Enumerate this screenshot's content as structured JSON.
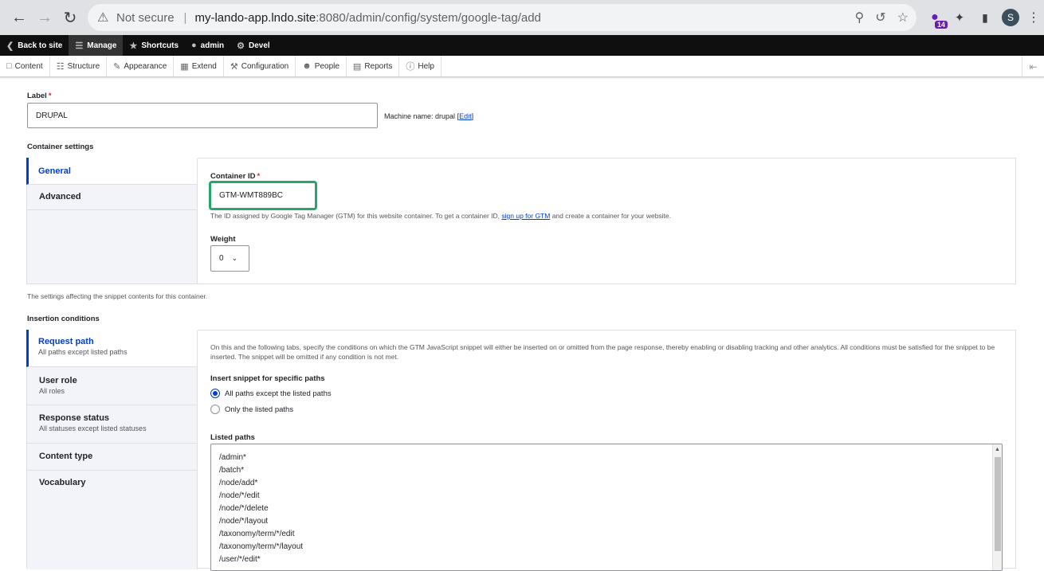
{
  "browser": {
    "warning_text": "Not secure",
    "url_host": "my-lando-app.lndo.site",
    "url_path": ":8080/admin/config/system/google-tag/add",
    "extension_badge": "14",
    "profile_initial": "S"
  },
  "toolbar": {
    "back_to_site": "Back to site",
    "manage": "Manage",
    "shortcuts": "Shortcuts",
    "user": "admin",
    "devel": "Devel"
  },
  "tray": {
    "items": [
      "Content",
      "Structure",
      "Appearance",
      "Extend",
      "Configuration",
      "People",
      "Reports",
      "Help"
    ]
  },
  "form": {
    "label_title": "Label",
    "label_value": "DRUPAL",
    "machine_name_prefix": "Machine name: drupal",
    "machine_edit_link": "Edit",
    "container_settings_title": "Container settings",
    "container_tabs": [
      {
        "title": "General"
      },
      {
        "title": "Advanced"
      }
    ],
    "container_id_label": "Container ID",
    "container_id_value": "GTM-WMT889BC",
    "container_desc_before": "The ID assigned by Google Tag Manager (GTM) for this website container. To get a container ID,",
    "container_desc_link": "sign up for GTM",
    "container_desc_after": "and create a container for your website.",
    "weight_label": "Weight",
    "weight_value": "0",
    "settings_note": "The settings affecting the snippet contents for this container.",
    "insertion_title": "Insertion conditions",
    "insertion_tabs": [
      {
        "title": "Request path",
        "summary": "All paths except listed paths"
      },
      {
        "title": "User role",
        "summary": "All roles"
      },
      {
        "title": "Response status",
        "summary": "All statuses except listed statuses"
      },
      {
        "title": "Content type",
        "summary": ""
      },
      {
        "title": "Vocabulary",
        "summary": ""
      }
    ],
    "insertion_intro": "On this and the following tabs, specify the conditions on which the GTM JavaScript snippet will either be inserted on or omitted from the page response, thereby enabling or disabling tracking and other analytics. All conditions must be satisfied for the snippet to be inserted. The snippet will be omitted if any condition is not met.",
    "insert_paths_label": "Insert snippet for specific paths",
    "radio_options": [
      "All paths except the listed paths",
      "Only the listed paths"
    ],
    "listed_paths_label": "Listed paths",
    "listed_paths": [
      "/admin*",
      "/batch*",
      "/node/add*",
      "/node/*/edit",
      "/node/*/delete",
      "/node/*/layout",
      "/taxonomy/term/*/edit",
      "/taxonomy/term/*/layout",
      "/user/*/edit*"
    ]
  }
}
